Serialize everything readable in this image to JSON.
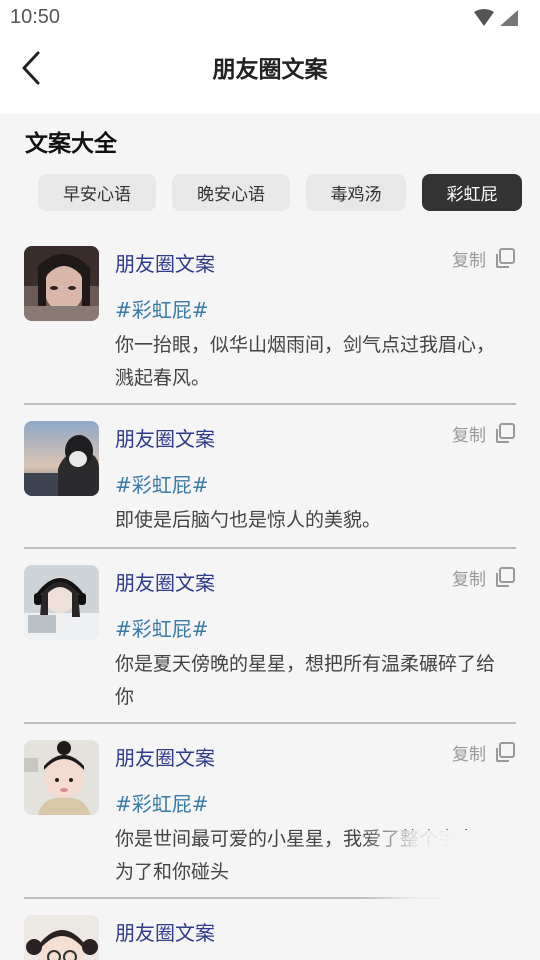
{
  "status_bar": {
    "time": "10:50"
  },
  "header": {
    "title": "朋友圈文案"
  },
  "section": {
    "title": "文案大全"
  },
  "tabs": [
    {
      "label": "早安心语",
      "active": false
    },
    {
      "label": "晚安心语",
      "active": false
    },
    {
      "label": "毒鸡汤",
      "active": false
    },
    {
      "label": "彩虹屁",
      "active": true
    }
  ],
  "cards": [
    {
      "name": "朋友圈文案",
      "copy_label": "复制",
      "tag": "#彩虹屁#",
      "text": "你一抬眼，似华山烟雨间，剑气点过我眉心，溅起春风。"
    },
    {
      "name": "朋友圈文案",
      "copy_label": "复制",
      "tag": "#彩虹屁#",
      "text": "即使是后脑勺也是惊人的美貌。"
    },
    {
      "name": "朋友圈文案",
      "copy_label": "复制",
      "tag": "#彩虹屁#",
      "text": "你是夏天傍晚的星星，想把所有温柔碾碎了给你"
    },
    {
      "name": "朋友圈文案",
      "copy_label": "复制",
      "tag": "#彩虹屁#",
      "text": "你是世间最可爱的小星星，我爱了整个宇宙只为了和你碰头"
    },
    {
      "name": "朋友圈文案"
    }
  ],
  "colors": {
    "active_tab": "#333333",
    "name": "#2f3b8a",
    "tag": "#3a7ca5"
  }
}
